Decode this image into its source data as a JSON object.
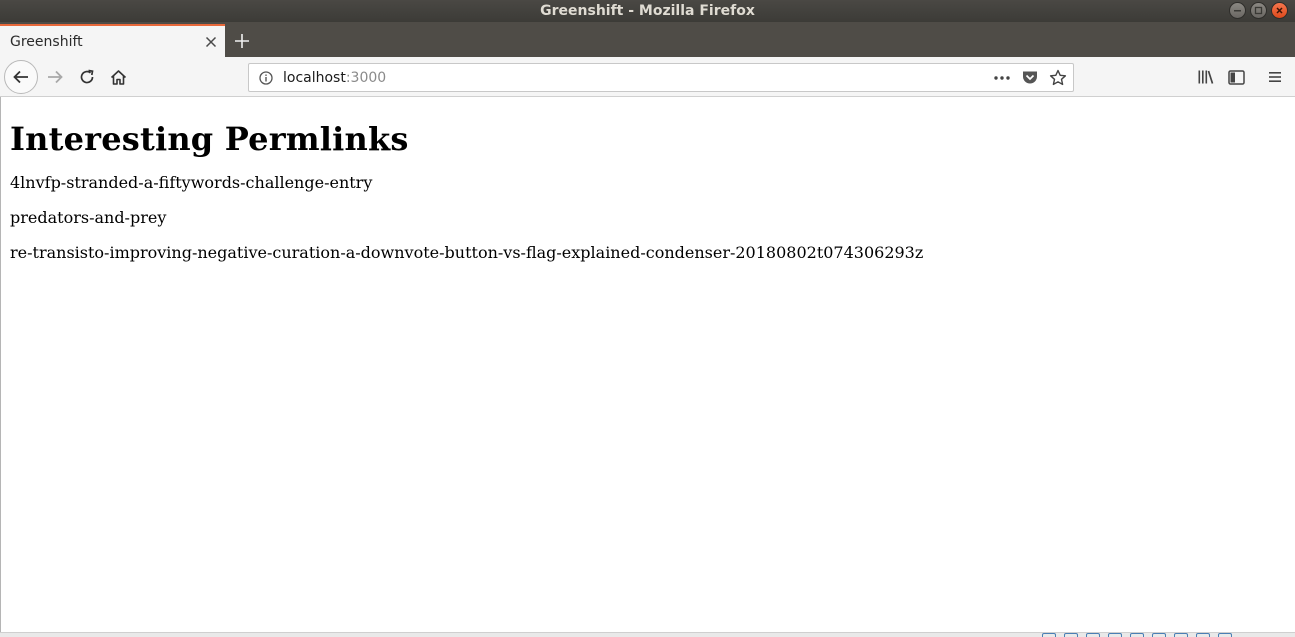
{
  "window": {
    "title": "Greenshift - Mozilla Firefox"
  },
  "tabs": [
    {
      "label": "Greenshift",
      "active": true
    }
  ],
  "urlbar": {
    "host": "localhost",
    "port": ":3000"
  },
  "icons": {
    "back": "arrow-left-icon",
    "forward": "arrow-right-icon",
    "reload": "reload-icon",
    "home": "home-icon",
    "info": "info-icon",
    "page_actions": "more-dots-icon",
    "pocket": "pocket-icon",
    "bookmark": "star-icon",
    "library": "library-icon",
    "sidebar": "sidebar-icon",
    "menu": "hamburger-menu-icon",
    "close_tab": "close-icon",
    "new_tab": "plus-icon"
  },
  "colors": {
    "active_tab_accent": "#e8693b",
    "titlebar": "#3c3b37",
    "close_button": "#de4a1c"
  },
  "page": {
    "title": "Interesting Permlinks",
    "permlinks": [
      "4lnvfp-stranded-a-fiftywords-challenge-entry",
      "predators-and-prey",
      "re-transisto-improving-negative-curation-a-downvote-button-vs-flag-explained-condenser-20180802t074306293z"
    ]
  }
}
